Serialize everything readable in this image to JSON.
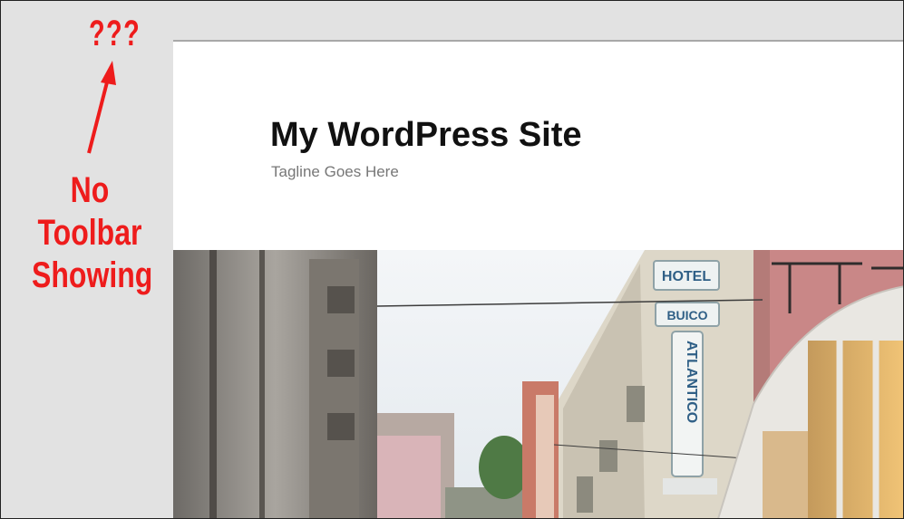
{
  "annotation": {
    "question": "???",
    "note_lines": [
      "No",
      "Toolbar",
      "Showing"
    ],
    "color": "#ee1c1c"
  },
  "site": {
    "title": "My WordPress Site",
    "tagline": "Tagline Goes Here"
  },
  "header_image": {
    "subject": "street-photo-hotel-buico-atlantico-tram"
  },
  "hotel_sign": {
    "lines": [
      "HOTEL",
      "BUICO"
    ],
    "vertical": "ATLANTICO"
  }
}
